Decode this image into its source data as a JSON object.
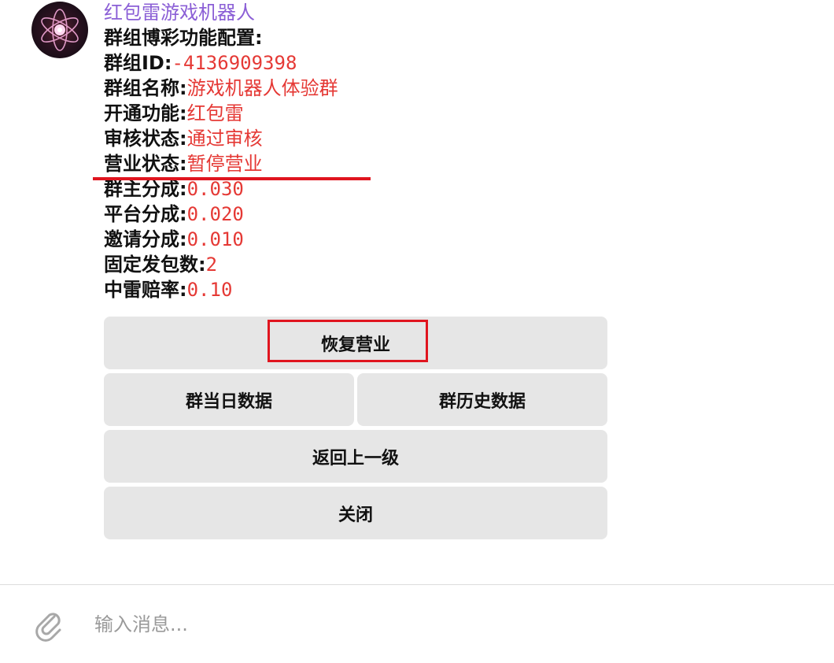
{
  "bot": {
    "name": "红包雷游戏机器人"
  },
  "message": {
    "heading": "群组博彩功能配置:",
    "fields": [
      {
        "label": "群组ID:",
        "value": "-4136909398"
      },
      {
        "label": "群组名称:",
        "value": "游戏机器人体验群"
      },
      {
        "label": "开通功能:",
        "value": "红包雷"
      },
      {
        "label": "审核状态:",
        "value": "通过审核"
      },
      {
        "label": "营业状态:",
        "value": "暂停营业"
      },
      {
        "label": "群主分成:",
        "value": "0.030"
      },
      {
        "label": "平台分成:",
        "value": "0.020"
      },
      {
        "label": "邀请分成:",
        "value": "0.010"
      },
      {
        "label": "固定发包数:",
        "value": "2"
      },
      {
        "label": "中雷赔率:",
        "value": "0.10"
      }
    ]
  },
  "keyboard": {
    "resume": "恢复营业",
    "today_data": "群当日数据",
    "history_data": "群历史数据",
    "back": "返回上一级",
    "close": "关闭"
  },
  "composer": {
    "placeholder": "输入消息..."
  },
  "colors": {
    "accent_name": "#8b5fd6",
    "value_red": "#e53935",
    "annotation_red": "#e0151f",
    "button_bg": "#e6e6e6"
  },
  "icons": {
    "avatar": "atom-icon",
    "attach": "paperclip-icon"
  }
}
